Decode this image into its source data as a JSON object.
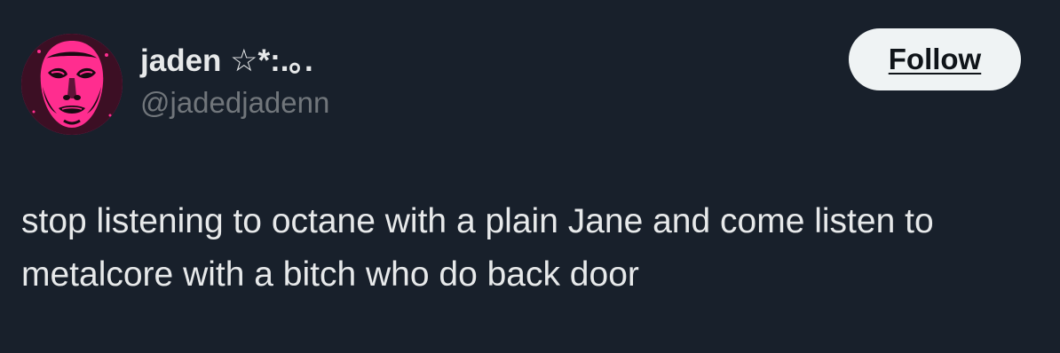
{
  "author": {
    "display_name": "jaden ☆*:.｡.",
    "handle": "@jadedjadenn",
    "avatar_icon": "pink-face-avatar-icon"
  },
  "actions": {
    "follow_label": "Follow"
  },
  "tweet": {
    "text": "stop listening to octane with a plain Jane and come listen to metalcore with a bitch who do back door"
  },
  "colors": {
    "background": "#18202b",
    "text_primary": "#e7e9ea",
    "text_secondary": "#71767b",
    "button_bg": "#eff3f4",
    "avatar_pink": "#ff2d8f"
  }
}
